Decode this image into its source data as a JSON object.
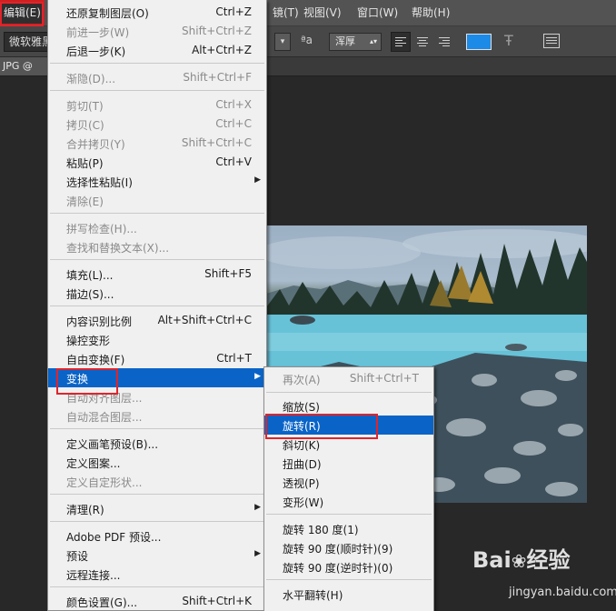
{
  "menubar": {
    "edit": "编辑(E)",
    "filter": "镜(T)",
    "view": "视图(V)",
    "window": "窗口(W)",
    "help": "帮助(H)"
  },
  "options": {
    "font": "微软雅黑",
    "aa_icon": "ªa",
    "antialias": "浑厚",
    "color_hex": "#1c8be8"
  },
  "doc_tab": "JPG @ 66",
  "edit_menu": {
    "items": [
      {
        "label": "还原复制图层(O)",
        "shortcut": "Ctrl+Z",
        "disabled": false
      },
      {
        "label": "前进一步(W)",
        "shortcut": "Shift+Ctrl+Z",
        "disabled": true
      },
      {
        "label": "后退一步(K)",
        "shortcut": "Alt+Ctrl+Z",
        "disabled": false
      },
      {
        "label": "渐隐(D)...",
        "shortcut": "Shift+Ctrl+F",
        "disabled": true
      },
      {
        "label": "剪切(T)",
        "shortcut": "Ctrl+X",
        "disabled": true
      },
      {
        "label": "拷贝(C)",
        "shortcut": "Ctrl+C",
        "disabled": true
      },
      {
        "label": "合并拷贝(Y)",
        "shortcut": "Shift+Ctrl+C",
        "disabled": true
      },
      {
        "label": "粘贴(P)",
        "shortcut": "Ctrl+V",
        "disabled": false
      },
      {
        "label": "选择性粘贴(I)",
        "shortcut": "",
        "disabled": false,
        "submenu": true
      },
      {
        "label": "清除(E)",
        "shortcut": "",
        "disabled": true
      },
      {
        "label": "拼写检查(H)...",
        "shortcut": "",
        "disabled": true
      },
      {
        "label": "查找和替换文本(X)...",
        "shortcut": "",
        "disabled": true
      },
      {
        "label": "填充(L)...",
        "shortcut": "Shift+F5",
        "disabled": false
      },
      {
        "label": "描边(S)...",
        "shortcut": "",
        "disabled": false
      },
      {
        "label": "内容识别比例",
        "shortcut": "Alt+Shift+Ctrl+C",
        "disabled": false
      },
      {
        "label": "操控变形",
        "shortcut": "",
        "disabled": false
      },
      {
        "label": "自由变换(F)",
        "shortcut": "Ctrl+T",
        "disabled": false
      },
      {
        "label": "变换",
        "shortcut": "",
        "disabled": false,
        "submenu": true,
        "highlighted": true
      },
      {
        "label": "自动对齐图层...",
        "shortcut": "",
        "disabled": true
      },
      {
        "label": "自动混合图层...",
        "shortcut": "",
        "disabled": true
      },
      {
        "label": "定义画笔预设(B)...",
        "shortcut": "",
        "disabled": false
      },
      {
        "label": "定义图案...",
        "shortcut": "",
        "disabled": false
      },
      {
        "label": "定义自定形状...",
        "shortcut": "",
        "disabled": true
      },
      {
        "label": "清理(R)",
        "shortcut": "",
        "disabled": false,
        "submenu": true
      },
      {
        "label": "Adobe PDF 预设...",
        "shortcut": "",
        "disabled": false
      },
      {
        "label": "预设",
        "shortcut": "",
        "disabled": false,
        "submenu": true
      },
      {
        "label": "远程连接...",
        "shortcut": "",
        "disabled": false
      },
      {
        "label": "颜色设置(G)...",
        "shortcut": "Shift+Ctrl+K",
        "disabled": false
      }
    ]
  },
  "transform_menu": {
    "items": [
      {
        "label": "再次(A)",
        "shortcut": "Shift+Ctrl+T",
        "disabled": true
      },
      {
        "label": "缩放(S)",
        "shortcut": "",
        "disabled": false
      },
      {
        "label": "旋转(R)",
        "shortcut": "",
        "disabled": false,
        "highlighted": true
      },
      {
        "label": "斜切(K)",
        "shortcut": "",
        "disabled": false
      },
      {
        "label": "扭曲(D)",
        "shortcut": "",
        "disabled": false
      },
      {
        "label": "透视(P)",
        "shortcut": "",
        "disabled": false
      },
      {
        "label": "变形(W)",
        "shortcut": "",
        "disabled": false
      },
      {
        "label": "旋转 180 度(1)",
        "shortcut": "",
        "disabled": false
      },
      {
        "label": "旋转 90 度(顺时针)(9)",
        "shortcut": "",
        "disabled": false
      },
      {
        "label": "旋转 90 度(逆时针)(0)",
        "shortcut": "",
        "disabled": false
      },
      {
        "label": "水平翻转(H)",
        "shortcut": "",
        "disabled": false
      }
    ]
  }
}
